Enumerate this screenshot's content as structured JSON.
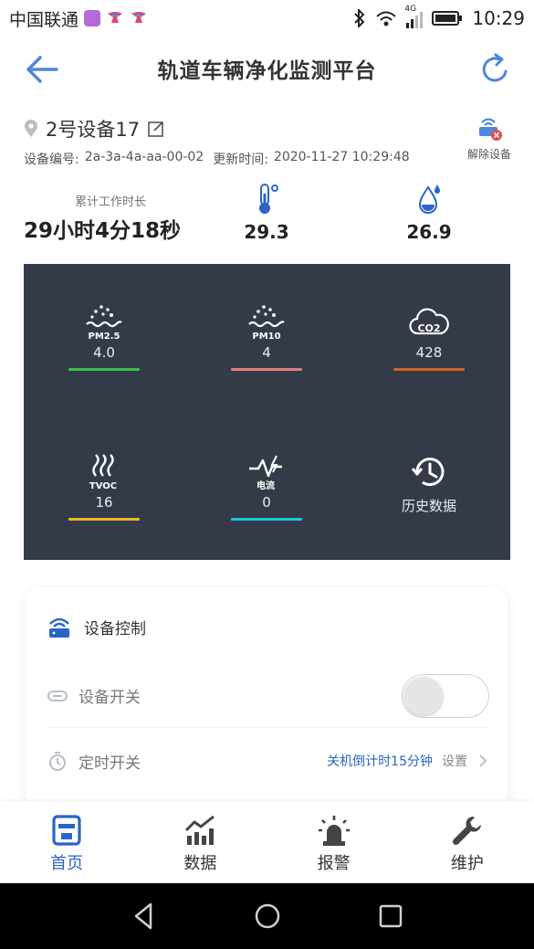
{
  "status_bar": {
    "carrier": "中国联通",
    "network": "4G",
    "time": "10:29"
  },
  "header": {
    "title": "轨道车辆净化监测平台",
    "back_icon": "back-arrow-icon",
    "refresh_icon": "refresh-icon"
  },
  "device": {
    "name": "2号设备17",
    "code_label": "设备编号:",
    "code": "2a-3a-4a-aa-00-02",
    "update_label": "更新时间:",
    "update_time": "2020-11-27 10:29:48",
    "unbind_label": "解除设备"
  },
  "stats": {
    "work_label": "累计工作时长",
    "work_value": "29小时4分18秒",
    "temperature": "29.3",
    "humidity": "26.9"
  },
  "sensors": [
    {
      "name": "PM2.5",
      "value": "4.0",
      "color": "#3cba54"
    },
    {
      "name": "PM10",
      "value": "4",
      "color": "#e07f7a"
    },
    {
      "name": "CO2",
      "value": "428",
      "color": "#d0651f"
    },
    {
      "name": "TVOC",
      "value": "16",
      "color": "#f0b323"
    },
    {
      "name": "电流",
      "value": "0",
      "color": "#19c6e6"
    }
  ],
  "history_label": "历史数据",
  "control": {
    "title": "设备控制",
    "switch_label": "设备开关",
    "switch_on": false,
    "timer_label": "定时开关",
    "timer_status": "关机倒计时15分钟",
    "timer_set": "设置"
  },
  "tabs": [
    {
      "label": "首页",
      "active": true
    },
    {
      "label": "数据",
      "active": false
    },
    {
      "label": "报警",
      "active": false
    },
    {
      "label": "维护",
      "active": false
    }
  ],
  "colors": {
    "accent": "#2a64c8",
    "panel_bg": "#333b48"
  }
}
